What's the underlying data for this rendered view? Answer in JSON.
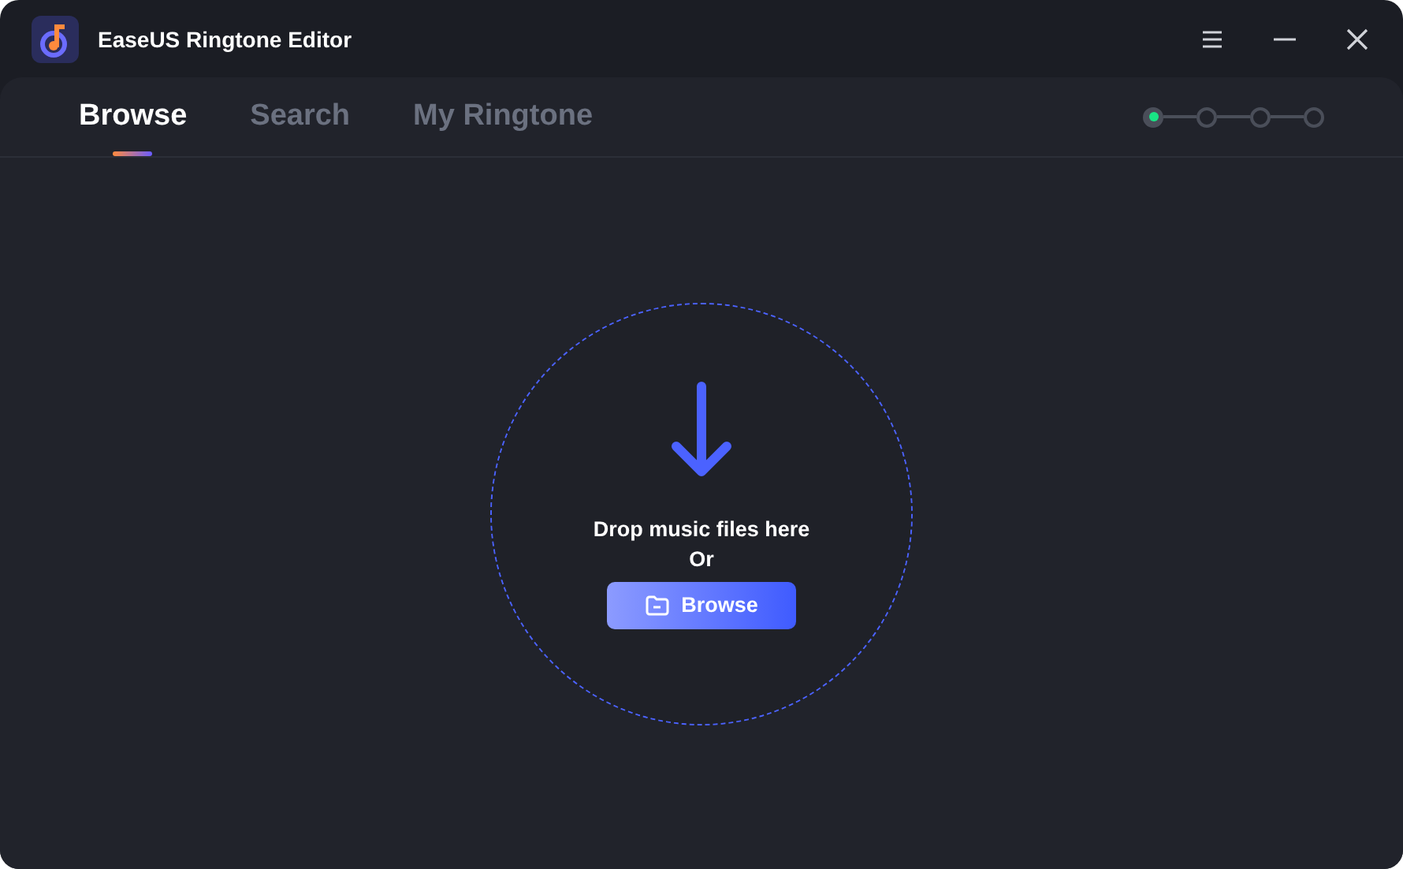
{
  "window": {
    "title": "EaseUS Ringtone Editor"
  },
  "tabs": [
    {
      "label": "Browse",
      "selected": true
    },
    {
      "label": "Search",
      "selected": false
    },
    {
      "label": "My Ringtone",
      "selected": false
    }
  ],
  "steps": [
    {
      "active": true
    },
    {
      "active": false
    },
    {
      "active": false
    },
    {
      "active": false
    }
  ],
  "drop_zone": {
    "text": "Drop music files here",
    "or": "Or",
    "button": "Browse"
  }
}
